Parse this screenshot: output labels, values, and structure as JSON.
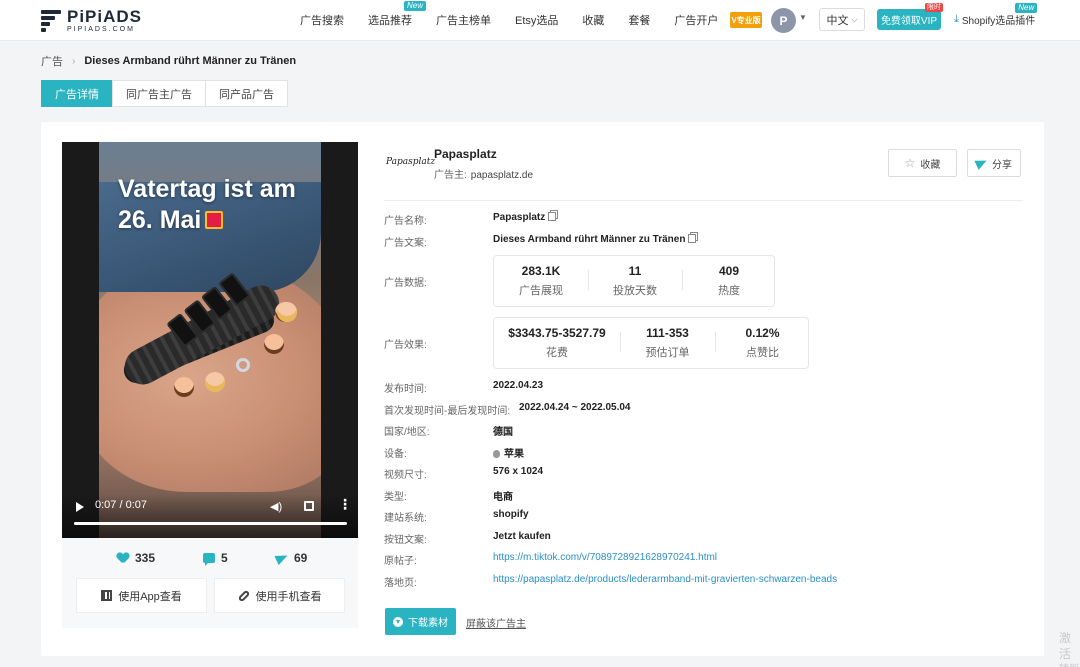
{
  "header": {
    "logo_name": "PiPiADS",
    "logo_sub": "PIPIADS.COM",
    "nav": [
      {
        "label": "广告搜索",
        "new": ""
      },
      {
        "label": "选品推荐",
        "new": "New"
      },
      {
        "label": "广告主榜单",
        "new": ""
      },
      {
        "label": "Etsy选品",
        "new": ""
      },
      {
        "label": "收藏",
        "new": ""
      },
      {
        "label": "套餐",
        "new": ""
      },
      {
        "label": "广告开户",
        "new": ""
      }
    ],
    "badge_text": "V专业版",
    "avatar_letter": "P",
    "language": "中文",
    "vip_label": "免费领取VIP",
    "vip_tag": "限时",
    "plugin_label": "Shopify选品插件",
    "plugin_new": "New"
  },
  "breadcrumb": {
    "root": "广告",
    "current": "Dieses Armband rührt Männer zu Tränen"
  },
  "tabs": [
    "广告详情",
    "同广告主广告",
    "同产品广告"
  ],
  "video": {
    "overlay_line1": "Vatertag ist am",
    "overlay_line2": "26. Mai",
    "time": "0:07 / 0:07"
  },
  "engagement": {
    "likes": "335",
    "comments": "5",
    "shares": "69",
    "app_button": "使用App查看",
    "phone_button": "使用手机查看"
  },
  "advertiser": {
    "logo_text": "Papasplatz",
    "name": "Papasplatz",
    "label": "广告主:",
    "domain": "papasplatz.de",
    "favorite": "收藏",
    "share": "分享"
  },
  "details": {
    "ad_name_label": "广告名称:",
    "ad_name": "Papasplatz",
    "ad_copy_label": "广告文案:",
    "ad_copy": "Dieses Armband rührt Männer zu Tränen",
    "ad_data_label": "广告数据:",
    "ad_data": [
      {
        "num": "283.1K",
        "lab": "广告展现"
      },
      {
        "num": "11",
        "lab": "投放天数"
      },
      {
        "num": "409",
        "lab": "热度"
      }
    ],
    "ad_effect_label": "广告效果:",
    "ad_effect": [
      {
        "num": "$3343.75-3527.79",
        "lab": "花费"
      },
      {
        "num": "111-353",
        "lab": "预估订单"
      },
      {
        "num": "0.12%",
        "lab": "点赞比"
      }
    ],
    "publish_label": "发布时间:",
    "publish": "2022.04.23",
    "seen_label": "首次发现时间-最后发现时间:",
    "seen": "2022.04.24 ~ 2022.05.04",
    "country_label": "国家/地区:",
    "country": "德国",
    "device_label": "设备:",
    "device": "苹果",
    "size_label": "视频尺寸:",
    "size": "576 x 1024",
    "type_label": "类型:",
    "type": "电商",
    "platform_label": "建站系统:",
    "platform": "shopify",
    "cta_label": "按钮文案:",
    "cta": "Jetzt kaufen",
    "original_label": "原帖子:",
    "original_url": "https://m.tiktok.com/v/7089728921628970241.html",
    "landing_label": "落地页:",
    "landing_url": "https://papasplatz.de/products/lederarmband-mit-gravierten-schwarzen-beads"
  },
  "actions": {
    "download": "下载素材",
    "block": "屏蔽该广告主"
  },
  "watermark": {
    "line1": "激活",
    "line2": "转到"
  },
  "colors": {
    "accent": "#2ab3c1",
    "link": "#2a8fc7",
    "vip_tag": "#ef4444"
  }
}
